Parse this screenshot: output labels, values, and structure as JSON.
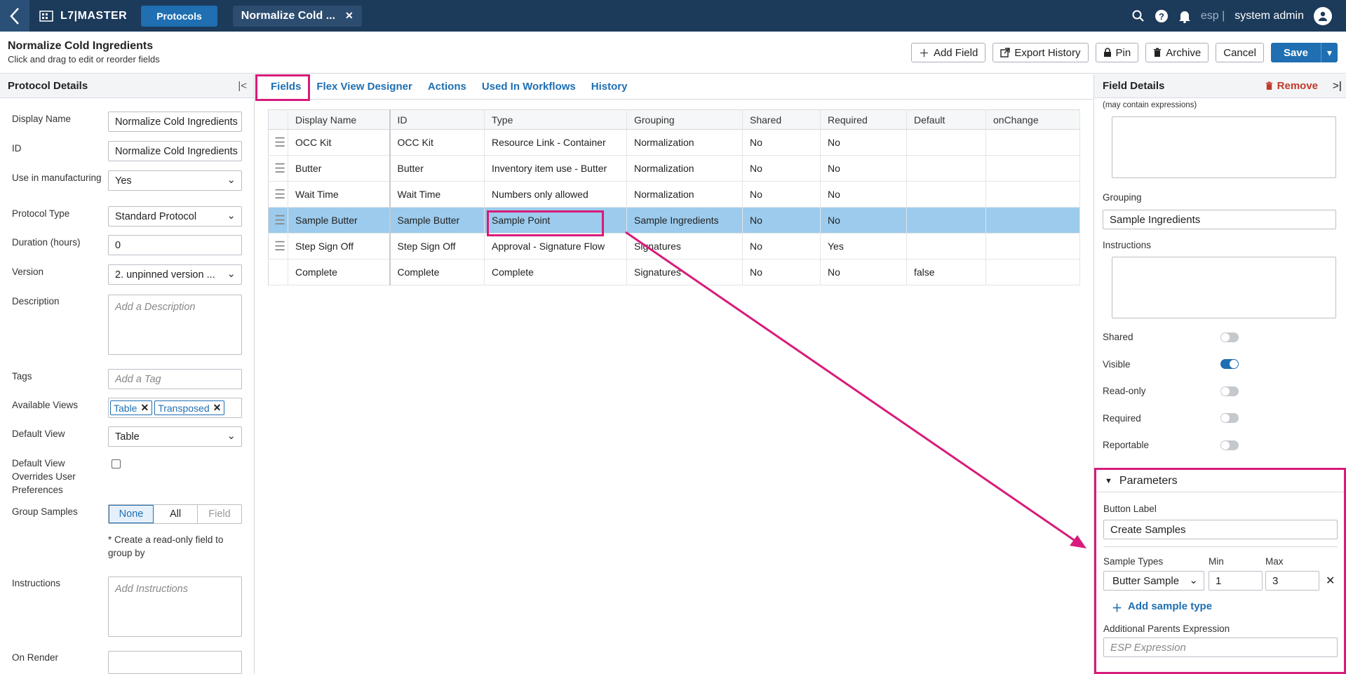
{
  "topbar": {
    "logo_text": "L7|MASTER",
    "protocols_label": "Protocols",
    "doc_tab_label": "Normalize Cold ...",
    "user_short": "esp |",
    "user_name": "system admin"
  },
  "header": {
    "title": "Normalize Cold Ingredients",
    "subtitle": "Click and drag to edit or reorder fields",
    "add_field": "Add Field",
    "export_history": "Export History",
    "pin": "Pin",
    "archive": "Archive",
    "cancel": "Cancel",
    "save": "Save"
  },
  "protocol_details": {
    "heading": "Protocol Details",
    "display_name_label": "Display Name",
    "display_name_value": "Normalize Cold Ingredients",
    "id_label": "ID",
    "id_value": "Normalize Cold Ingredients",
    "use_in_mfg_label": "Use in manufacturing",
    "use_in_mfg_value": "Yes",
    "protocol_type_label": "Protocol Type",
    "protocol_type_value": "Standard Protocol",
    "duration_label": "Duration (hours)",
    "duration_value": "0",
    "version_label": "Version",
    "version_value": "2. unpinned version ...",
    "description_label": "Description",
    "description_placeholder": "Add a Description",
    "tags_label": "Tags",
    "tags_placeholder": "Add a Tag",
    "available_views_label": "Available Views",
    "available_views": [
      "Table",
      "Transposed"
    ],
    "default_view_label": "Default View",
    "default_view_value": "Table",
    "override_label": "Default View Overrides User Preferences",
    "group_samples_label": "Group Samples",
    "group_samples_options": [
      "None",
      "All",
      "Field"
    ],
    "group_note": "* Create a read-only field to group by",
    "instructions_label": "Instructions",
    "instructions_placeholder": "Add Instructions",
    "on_render_label": "On Render"
  },
  "tabs": [
    "Fields",
    "Flex View Designer",
    "Actions",
    "Used In Workflows",
    "History"
  ],
  "table": {
    "columns": [
      "Display Name",
      "ID",
      "Type",
      "Grouping",
      "Shared",
      "Required",
      "Default",
      "onChange"
    ],
    "rows": [
      [
        "OCC Kit",
        "OCC Kit",
        "Resource Link - Container",
        "Normalization",
        "No",
        "No",
        "",
        ""
      ],
      [
        "Butter",
        "Butter",
        "Inventory item use - Butter",
        "Normalization",
        "No",
        "No",
        "",
        ""
      ],
      [
        "Wait Time",
        "Wait Time",
        "Numbers only allowed",
        "Normalization",
        "No",
        "No",
        "",
        ""
      ],
      [
        "Sample Butter",
        "Sample Butter",
        "Sample Point",
        "Sample Ingredients",
        "No",
        "No",
        "",
        ""
      ],
      [
        "Step Sign Off",
        "Step Sign Off",
        "Approval - Signature Flow",
        "Signatures",
        "No",
        "Yes",
        "",
        ""
      ],
      [
        "Complete",
        "Complete",
        "Complete",
        "Signatures",
        "No",
        "No",
        "false",
        ""
      ]
    ]
  },
  "field_details": {
    "heading": "Field Details",
    "remove": "Remove",
    "expr_note": "(may contain expressions)",
    "grouping_label": "Grouping",
    "grouping_value": "Sample Ingredients",
    "instructions_label": "Instructions",
    "shared_label": "Shared",
    "visible_label": "Visible",
    "readonly_label": "Read-only",
    "required_label": "Required",
    "reportable_label": "Reportable",
    "parameters_heading": "Parameters",
    "button_label_label": "Button Label",
    "button_label_value": "Create Samples",
    "sample_types_label": "Sample Types",
    "min_label": "Min",
    "max_label": "Max",
    "sample_type_value": "Butter Sample",
    "min_value": "1",
    "max_value": "3",
    "add_sample_type": "Add sample type",
    "parents_expr_label": "Additional Parents Expression",
    "parents_expr_placeholder": "ESP Expression"
  },
  "colors": {
    "accent": "#1f6fb2",
    "highlight": "#d81b7a",
    "topbar": "#1c3a5a",
    "selected_row": "#9ccbed"
  }
}
